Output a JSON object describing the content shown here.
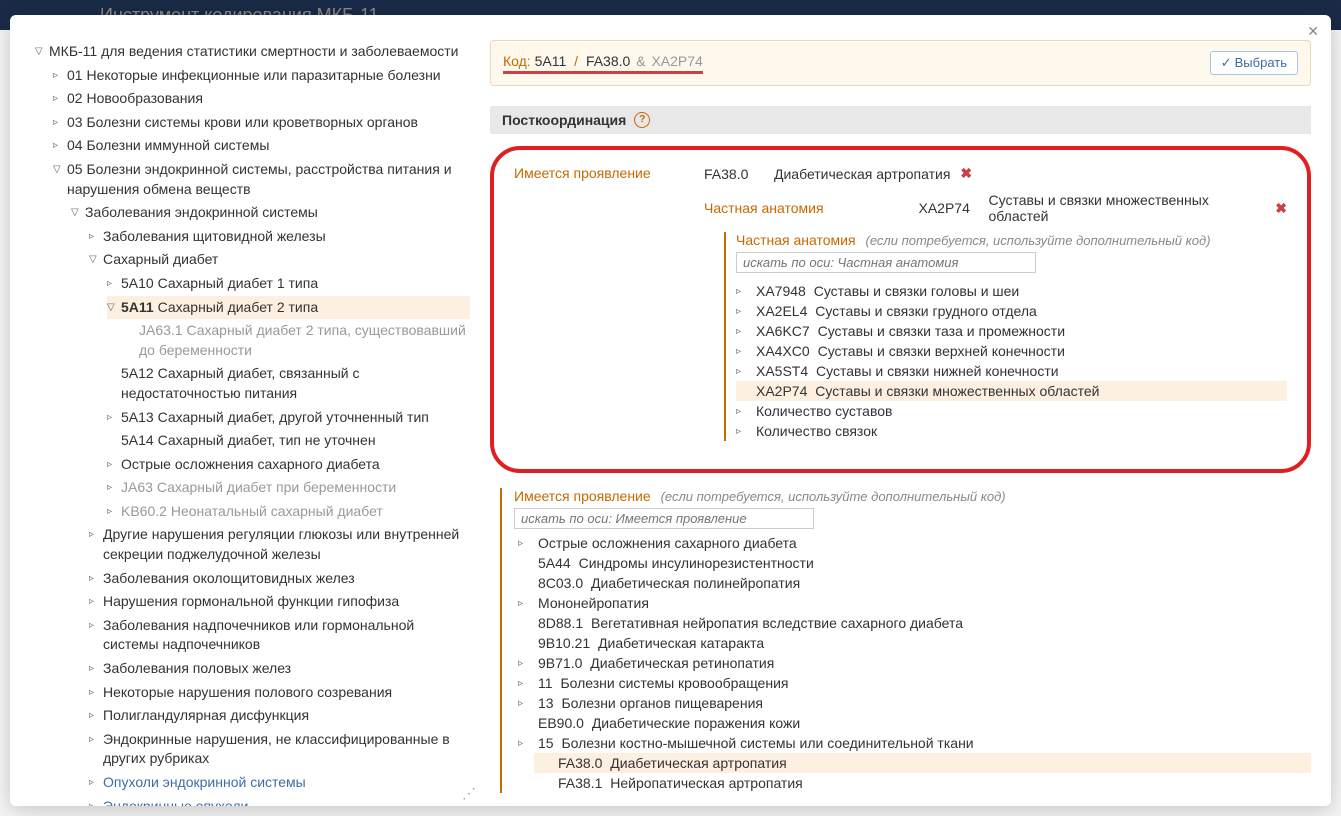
{
  "bg_title": "Инструмент кодирования МКБ-11",
  "code_bar": {
    "label": "Код:",
    "code1": "5A11",
    "sep": "/",
    "code2": "FA38.0",
    "amp": "&",
    "code3": "XA2P74",
    "select": "Выбрать"
  },
  "tree": {
    "root": "МКБ-11 для ведения статистики смертности и заболеваемости",
    "ch01": "Некоторые инфекционные или паразитарные болезни",
    "ch02": "Новообразования",
    "ch03": "Болезни системы крови или кроветворных органов",
    "ch04": "Болезни иммунной системы",
    "ch05": "Болезни эндокринной системы, расстройства питания и нарушения обмена веществ",
    "n1": "Заболевания эндокринной системы",
    "n2": "Заболевания щитовидной железы",
    "n3": "Сахарный диабет",
    "c5a10": "Сахарный диабет 1 типа",
    "c5a11": "Сахарный диабет 2 типа",
    "ja631": "Сахарный диабет 2 типа, существовавший до беременности",
    "c5a12": "Сахарный диабет, связанный с недостаточностью питания",
    "c5a13": "Сахарный диабет, другой уточненный тип",
    "c5a14": "Сахарный диабет, тип не уточнен",
    "n4": "Острые осложнения сахарного диабета",
    "ja63": "Сахарный диабет при беременности",
    "kb602": "Неонатальный сахарный диабет",
    "n5": "Другие нарушения регуляции глюкозы или внутренней секреции поджелудочной железы",
    "n6": "Заболевания околощитовидных желез",
    "n7": "Нарушения гормональной функции гипофиза",
    "n8": "Заболевания надпочечников или гормональной системы надпочечников",
    "n9": "Заболевания половых желез",
    "n10": "Некоторые нарушения полового созревания",
    "n11": "Полигландулярная дисфункция",
    "n12": "Эндокринные нарушения, не классифицированные в других рубриках",
    "n13": "Опухоли эндокринной системы",
    "n14": "Эндокринные опухоли"
  },
  "postcoord": {
    "title": "Посткоординация",
    "has_manifestation": "Имеется проявление",
    "fa380_code": "FA38.0",
    "fa380_label": "Диабетическая артропатия",
    "specific_anatomy": "Частная анатомия",
    "xa2p74_code": "XA2P74",
    "xa2p74_label": "Суставы и связки множественных областей",
    "anatomy_axis_label": "Частная анатомия",
    "hint": "(если потребуется, используйте дополнительный код)",
    "search_placeholder": "искать по оси: Частная анатомия",
    "anat_items": [
      {
        "code": "XA7948",
        "label": "Суставы и связки головы и шеи"
      },
      {
        "code": "XA2EL4",
        "label": "Суставы и связки грудного отдела"
      },
      {
        "code": "XA6KC7",
        "label": "Суставы и связки таза и промежности"
      },
      {
        "code": "XA4XC0",
        "label": "Суставы и связки верхней конечности"
      },
      {
        "code": "XA5ST4",
        "label": "Суставы и связки нижней конечности"
      },
      {
        "code": "XA2P74",
        "label": "Суставы и связки множественных областей"
      }
    ],
    "joint_count": "Количество суставов",
    "ligament_count": "Количество связок"
  },
  "manifestation": {
    "label": "Имеется проявление",
    "hint": "(если потребуется, используйте дополнительный код)",
    "search_placeholder": "искать по оси: Имеется проявление",
    "items": [
      {
        "caret": "▹",
        "code": "",
        "label": "Острые осложнения сахарного диабета",
        "indent": 0
      },
      {
        "caret": "",
        "code": "5A44",
        "label": "Синдромы инсулинорезистентности",
        "indent": 0
      },
      {
        "caret": "",
        "code": "8C03.0",
        "label": "Диабетическая полинейропатия",
        "indent": 0
      },
      {
        "caret": "▹",
        "code": "",
        "label": "Мононейропатия",
        "indent": 0
      },
      {
        "caret": "",
        "code": "8D88.1",
        "label": "Вегетативная нейропатия вследствие сахарного диабета",
        "indent": 0
      },
      {
        "caret": "",
        "code": "9B10.21",
        "label": "Диабетическая катаракта",
        "indent": 0
      },
      {
        "caret": "▹",
        "code": "9B71.0",
        "label": "Диабетическая ретинопатия",
        "indent": 0
      },
      {
        "caret": "▹",
        "code": "11",
        "label": "Болезни системы кровообращения",
        "indent": 0
      },
      {
        "caret": "▹",
        "code": "13",
        "label": "Болезни органов пищеварения",
        "indent": 0
      },
      {
        "caret": "",
        "code": "EB90.0",
        "label": "Диабетические поражения кожи",
        "indent": 0
      },
      {
        "caret": "▹",
        "code": "15",
        "label": "Болезни костно-мышечной системы или соединительной ткани",
        "indent": 0
      },
      {
        "caret": "",
        "code": "FA38.0",
        "label": "Диабетическая артропатия",
        "indent": 1,
        "selected": true
      },
      {
        "caret": "",
        "code": "FA38.1",
        "label": "Нейропатическая артропатия",
        "indent": 1
      }
    ]
  }
}
